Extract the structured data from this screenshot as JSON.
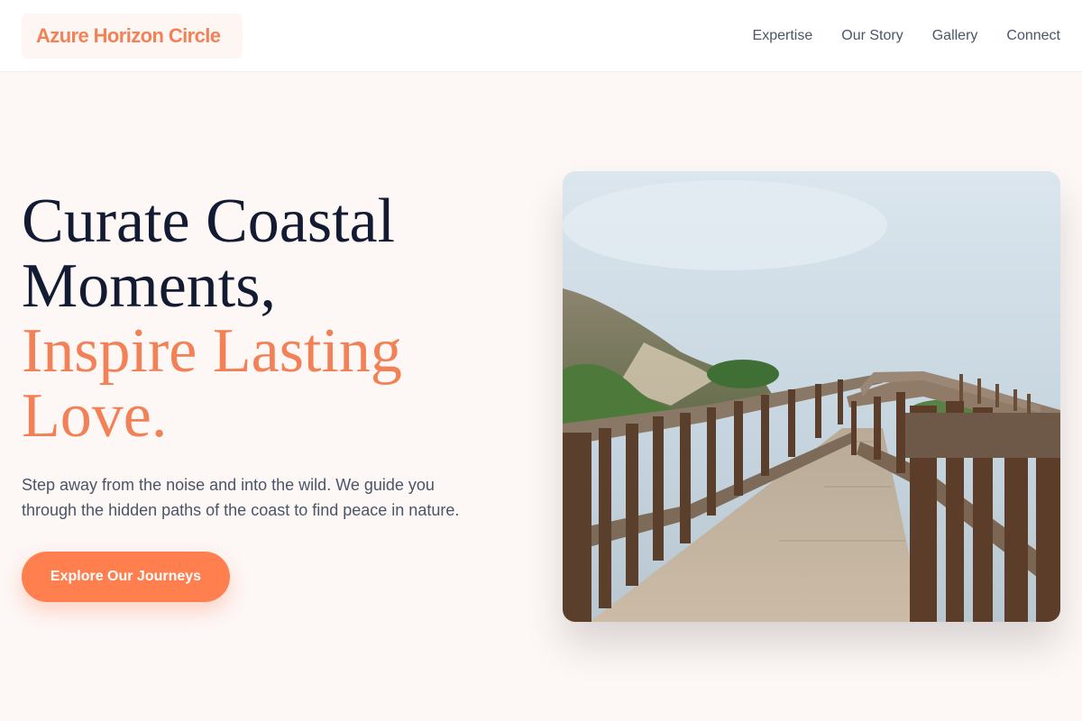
{
  "brand": {
    "name": "Azure Horizon Circle"
  },
  "nav": {
    "items": [
      "Expertise",
      "Our Story",
      "Gallery",
      "Connect"
    ]
  },
  "hero": {
    "title_line1": "Curate Coastal",
    "title_line2": "Moments,",
    "title_accent_line1": "Inspire Lasting",
    "title_accent_line2": "Love.",
    "subtitle": "Step away from the noise and into the wild. We guide you through the hidden paths of the coast to find peace in nature.",
    "cta_label": "Explore Our Journeys"
  },
  "colors": {
    "accent": "#f38157",
    "button": "#ff7f4f",
    "heading": "#121b31",
    "body_text": "#4a5568",
    "background": "#fdf7f6"
  }
}
